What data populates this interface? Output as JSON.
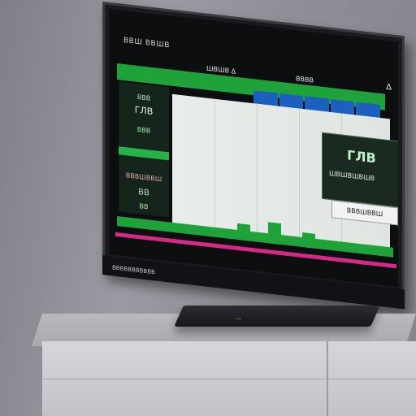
{
  "scene": {
    "screen": {
      "title": "ВВШ ВВШВ",
      "top_label_a": "ШВШВ Δ",
      "top_label_b": "ВВВВ",
      "corner_icon": "Δ",
      "left_panel": {
        "item1": "ВВВ",
        "item2": "ГЛВ",
        "item3": "ВВВ",
        "item4": "ВВВШВВШ",
        "item5": "ВВ",
        "item6": "ВВ"
      },
      "popup": {
        "number": "ГЛВ",
        "label": "ШВШВШВШВ",
        "button": "ВВВШВВШ"
      },
      "footer_label": "ВВВВВВВВВВВ"
    },
    "set_top_box": {
      "label": "—"
    },
    "colors": {
      "screen_green": "#1fa23a",
      "screen_blue": "#1b5fbf",
      "accent_pink": "#d42a86",
      "console": "#d0d1d4"
    }
  }
}
